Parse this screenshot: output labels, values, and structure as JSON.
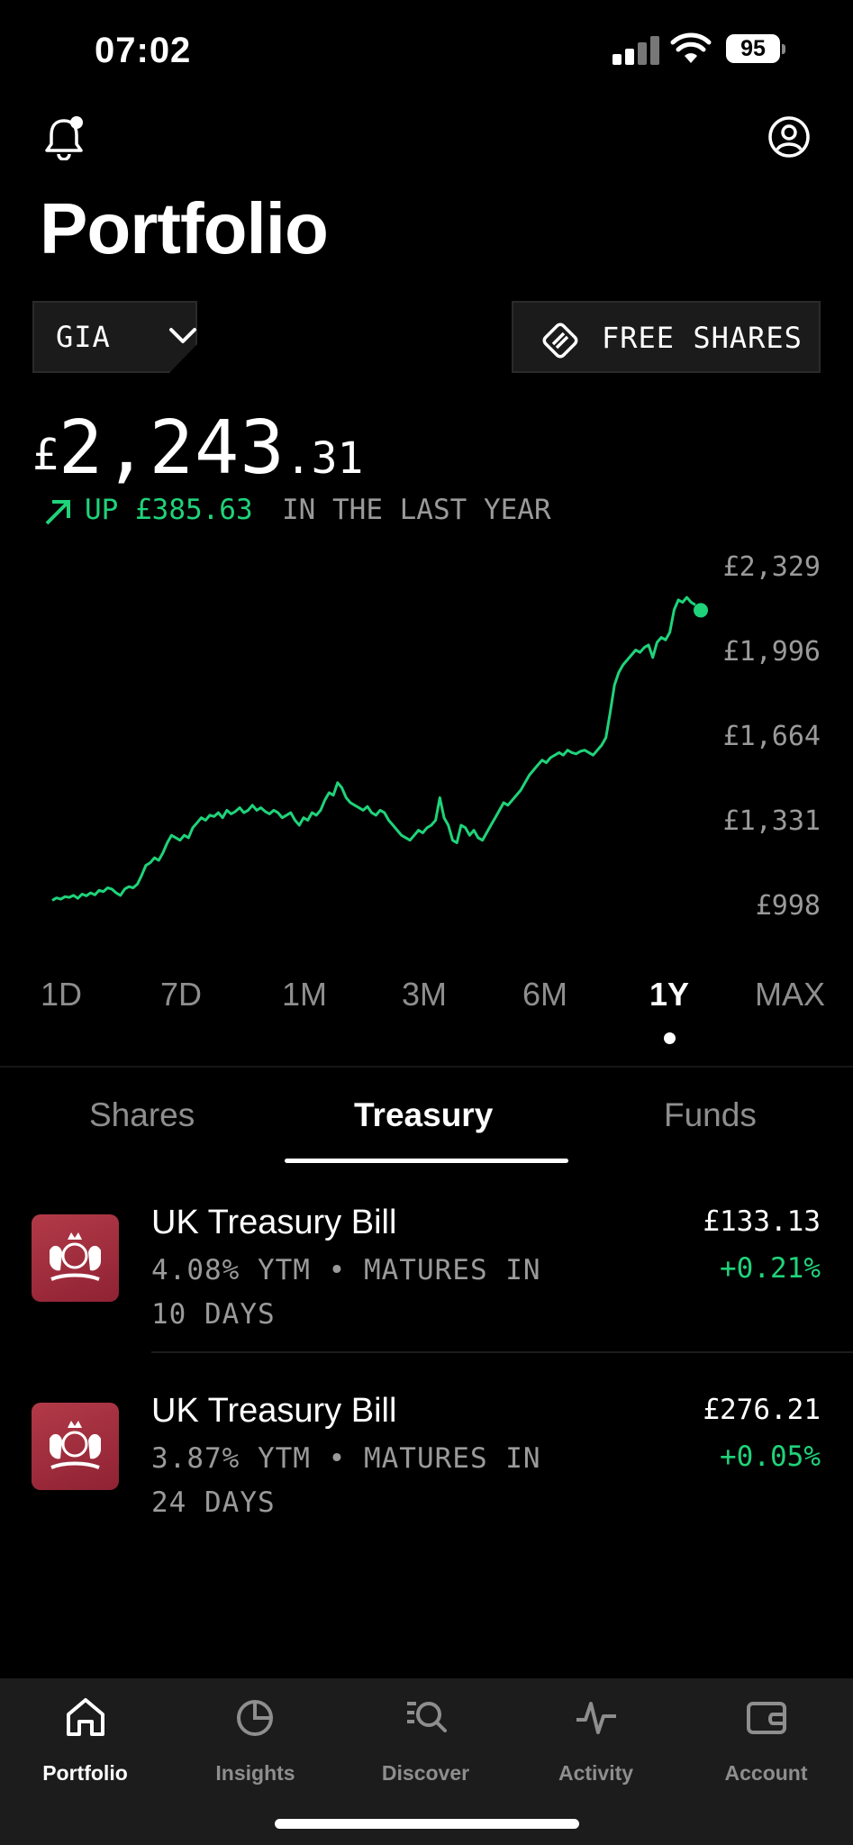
{
  "status": {
    "time": "07:02",
    "battery": "95"
  },
  "header": {
    "title": "Portfolio"
  },
  "account_select": {
    "label": "GIA"
  },
  "free_shares": {
    "label": "FREE SHARES"
  },
  "portfolio_value": {
    "currency": "£",
    "main": "2,243",
    "decimal": ".31"
  },
  "change": {
    "text": "UP £385.63",
    "period": "IN THE LAST YEAR",
    "color": "#1fd37a"
  },
  "chart_data": {
    "type": "line",
    "title": "",
    "y_ticks": [
      "£2,329",
      "£1,996",
      "£1,664",
      "£1,331",
      "£998"
    ],
    "ylim": [
      998,
      2329
    ],
    "color": "#1fd37a",
    "values": [
      1000,
      1010,
      1005,
      1015,
      1012,
      1020,
      1008,
      1025,
      1018,
      1030,
      1022,
      1040,
      1035,
      1050,
      1045,
      1030,
      1020,
      1045,
      1055,
      1050,
      1065,
      1100,
      1140,
      1150,
      1170,
      1160,
      1190,
      1230,
      1260,
      1250,
      1240,
      1260,
      1250,
      1290,
      1310,
      1330,
      1320,
      1340,
      1335,
      1350,
      1330,
      1360,
      1345,
      1355,
      1370,
      1350,
      1360,
      1380,
      1360,
      1370,
      1355,
      1345,
      1360,
      1350,
      1330,
      1340,
      1350,
      1320,
      1300,
      1330,
      1320,
      1350,
      1340,
      1360,
      1400,
      1430,
      1420,
      1470,
      1450,
      1410,
      1390,
      1380,
      1370,
      1360,
      1375,
      1350,
      1340,
      1360,
      1350,
      1320,
      1300,
      1280,
      1260,
      1250,
      1240,
      1260,
      1280,
      1270,
      1290,
      1300,
      1320,
      1410,
      1330,
      1300,
      1240,
      1230,
      1300,
      1290,
      1260,
      1280,
      1250,
      1240,
      1270,
      1300,
      1330,
      1360,
      1390,
      1380,
      1400,
      1420,
      1440,
      1470,
      1500,
      1520,
      1540,
      1560,
      1550,
      1570,
      1580,
      1590,
      1580,
      1600,
      1590,
      1585,
      1595,
      1600,
      1590,
      1580,
      1600,
      1620,
      1650,
      1750,
      1860,
      1910,
      1940,
      1960,
      1980,
      2000,
      1990,
      2010,
      2020,
      1970,
      2030,
      2050,
      2040,
      2070,
      2160,
      2200,
      2190,
      2210,
      2190,
      2180
    ]
  },
  "ranges": [
    "1D",
    "7D",
    "1M",
    "3M",
    "6M",
    "1Y",
    "MAX"
  ],
  "active_range": "1Y",
  "tabs": [
    "Shares",
    "Treasury",
    "Funds"
  ],
  "holdings": [
    {
      "name": "UK Treasury Bill",
      "line1": "4.08% YTM • MATURES IN",
      "line2": "10 DAYS",
      "price": "£133.13",
      "change": "+0.21%"
    },
    {
      "name": "UK Treasury Bill",
      "line1": "3.87% YTM • MATURES IN",
      "line2": "24 DAYS",
      "price": "£276.21",
      "change": "+0.05%"
    }
  ],
  "nav": [
    {
      "label": "Portfolio",
      "icon": "home-icon"
    },
    {
      "label": "Insights",
      "icon": "pie-chart-icon"
    },
    {
      "label": "Discover",
      "icon": "discover-search-icon"
    },
    {
      "label": "Activity",
      "icon": "pulse-icon"
    },
    {
      "label": "Account",
      "icon": "wallet-icon"
    }
  ]
}
